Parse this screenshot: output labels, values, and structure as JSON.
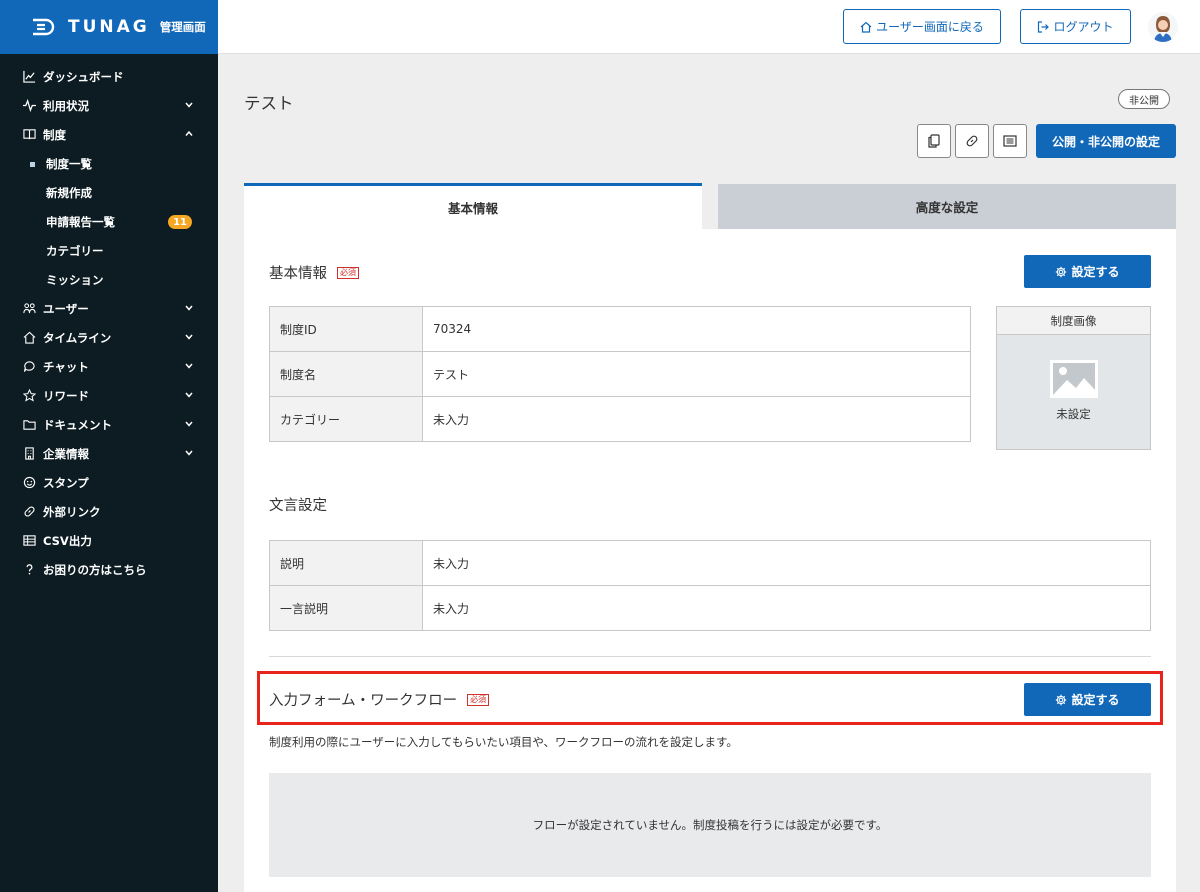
{
  "brand": {
    "name": "TUNAG",
    "subtitle": "管理画面"
  },
  "sidebar": {
    "items": [
      {
        "label": "ダッシュボード",
        "icon": "chart-icon",
        "chevron": ""
      },
      {
        "label": "利用状況",
        "icon": "pulse-icon",
        "chevron": "down"
      },
      {
        "label": "制度",
        "icon": "book-icon",
        "chevron": "up"
      },
      {
        "label": "ユーザー",
        "icon": "users-icon",
        "chevron": "down"
      },
      {
        "label": "タイムライン",
        "icon": "home-icon",
        "chevron": "down"
      },
      {
        "label": "チャット",
        "icon": "chat-icon",
        "chevron": "down"
      },
      {
        "label": "リワード",
        "icon": "star-icon",
        "chevron": "down"
      },
      {
        "label": "ドキュメント",
        "icon": "folder-icon",
        "chevron": "down"
      },
      {
        "label": "企業情報",
        "icon": "building-icon",
        "chevron": "down"
      },
      {
        "label": "スタンプ",
        "icon": "smile-icon",
        "chevron": ""
      },
      {
        "label": "外部リンク",
        "icon": "link-icon",
        "chevron": ""
      },
      {
        "label": "CSV出力",
        "icon": "table-icon",
        "chevron": ""
      },
      {
        "label": "お困りの方はこちら",
        "icon": "help-icon",
        "chevron": ""
      }
    ],
    "sub_items": [
      {
        "label": "制度一覧",
        "active": true
      },
      {
        "label": "新規作成"
      },
      {
        "label": "申請報告一覧",
        "badge": "11"
      },
      {
        "label": "カテゴリー"
      },
      {
        "label": "ミッション"
      }
    ]
  },
  "topbar": {
    "user_view_label": "ユーザー画面に戻る",
    "logout_label": "ログアウト"
  },
  "page": {
    "title": "テスト",
    "status": "非公開",
    "publish_label": "公開・非公開の設定"
  },
  "tabs": [
    {
      "label": "基本情報"
    },
    {
      "label": "高度な設定"
    }
  ],
  "basic": {
    "title": "基本情報",
    "required": "必須",
    "set_label": "設定する",
    "rows": [
      {
        "key": "制度ID",
        "value": "70324"
      },
      {
        "key": "制度名",
        "value": "テスト"
      },
      {
        "key": "カテゴリー",
        "value": "未入力"
      }
    ],
    "image_title": "制度画像",
    "image_status": "未設定"
  },
  "wording": {
    "title": "文言設定",
    "rows": [
      {
        "key": "説明",
        "value": "未入力"
      },
      {
        "key": "一言説明",
        "value": "未入力"
      }
    ]
  },
  "form": {
    "title": "入力フォーム・ワークフロー",
    "required": "必須",
    "set_label": "設定する",
    "description": "制度利用の際にユーザーに入力してもらいたい項目や、ワークフローの流れを設定します。",
    "empty_message": "フローが設定されていません。制度投稿を行うには設定が必要です。"
  },
  "colors": {
    "brand": "#1168b9",
    "sidebar": "#0c1c22",
    "badge": "#f5a623",
    "highlight": "#e8231b",
    "required": "#d0312d"
  }
}
